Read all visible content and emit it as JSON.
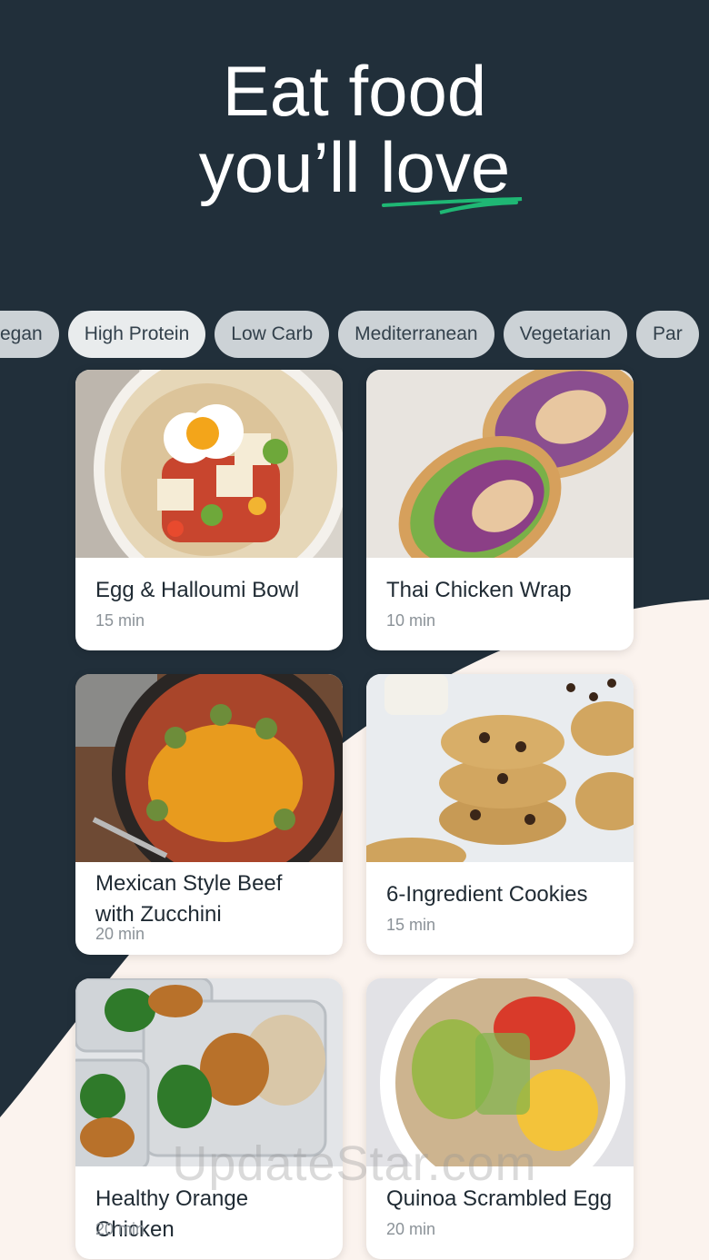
{
  "colors": {
    "background_dark": "#212f3a",
    "background_light": "#fbf3ee",
    "accent_green": "#1fb774"
  },
  "hero": {
    "line1": "Eat food",
    "line2_prefix": "you’ll",
    "line2_highlight": "love"
  },
  "filters": [
    {
      "label": "Vegan",
      "visible_text": "egan",
      "active": false
    },
    {
      "label": "High Protein",
      "active": true
    },
    {
      "label": "Low Carb",
      "active": false
    },
    {
      "label": "Mediterranean",
      "active": false
    },
    {
      "label": "Vegetarian",
      "active": false
    },
    {
      "label": "Par",
      "active": false
    }
  ],
  "recipes": [
    {
      "title": "Egg & Halloumi Bowl",
      "time": "15 min"
    },
    {
      "title": "Thai Chicken Wrap",
      "time": "10 min"
    },
    {
      "title_line1": "Mexican Style Beef",
      "title_line2": "with Zucchini",
      "time": "20 min"
    },
    {
      "title": "6-Ingredient Cookies",
      "time": "15 min"
    },
    {
      "title": "Healthy Orange Chicken",
      "time": "20 min"
    },
    {
      "title": "Quinoa Scrambled Egg",
      "time": "20 min"
    }
  ],
  "watermark": "UpdateStar.com"
}
